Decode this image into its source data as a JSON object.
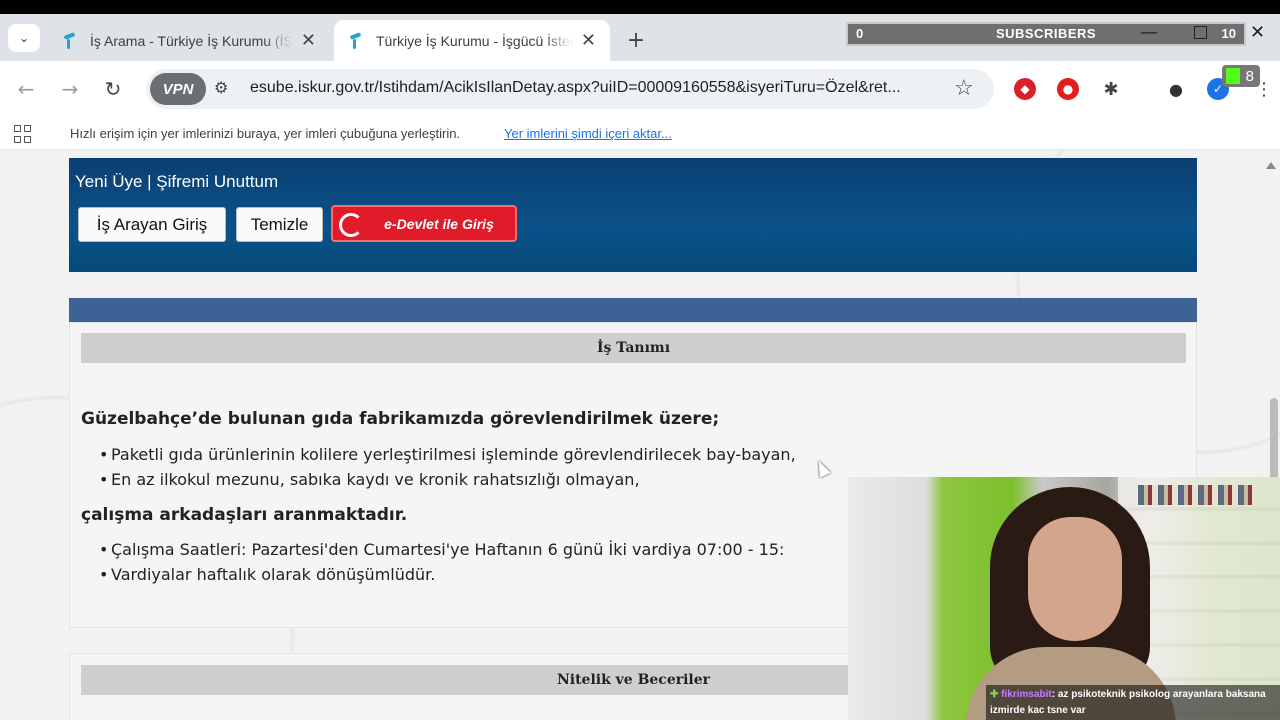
{
  "browser": {
    "tabs": [
      {
        "title": "İş Arama - Türkiye İş Kurumu (İŞ",
        "active": false
      },
      {
        "title": "Türkiye İş Kurumu - İşgücü İster",
        "active": true
      }
    ],
    "new_tab": "+",
    "url": "esube.iskur.gov.tr/Istihdam/AcikIsIlanDetay.aspx?uiID=00009160558&isyeriTuru=Özel&ret...",
    "vpn_label": "VPN",
    "bookmarks_message": "Hızlı erişim için yer imlerinizi buraya, yer imleri çubuğuna yerleştirin.",
    "bookmarks_link": "Yer imlerini şimdi içeri aktar...",
    "extension_badge": "8"
  },
  "overlay": {
    "left_count": "0",
    "label": "SUBSCRIBERS",
    "right_count": "10"
  },
  "header": {
    "links": "Yeni Üye |  Şifremi Unuttum",
    "login_button": "İş Arayan Giriş",
    "clear_button": "Temizle",
    "edevlet_button": "e-Devlet ile Giriş"
  },
  "job": {
    "section_title": "İş Tanımı",
    "intro": "Güzelbahçe’de bulunan gıda fabrikamızda görevlendirilmek üzere;",
    "requirements": [
      "Paketli gıda ürünlerinin kolilere yerleştirilmesi işleminde görevlendirilecek bay-bayan,",
      "En az ilkokul mezunu, sabıka kaydı ve kronik rahatsızlığı olmayan,"
    ],
    "middle": "çalışma arkadaşları aranmaktadır.",
    "details": [
      "Çalışma Saatleri: Pazartesi'den Cumartesi'ye Haftanın 6 günü İki vardiya 07:00 - 15:",
      "Vardiyalar haftalık olarak dönüşümlüdür."
    ],
    "section2_title": "Nitelik ve Beceriler"
  },
  "chat": {
    "user": "fikrimsabit",
    "message_line1": ": az psikoteknik psikolog arayanlara baksana",
    "message_line2": "izmirde kac tsne var"
  }
}
